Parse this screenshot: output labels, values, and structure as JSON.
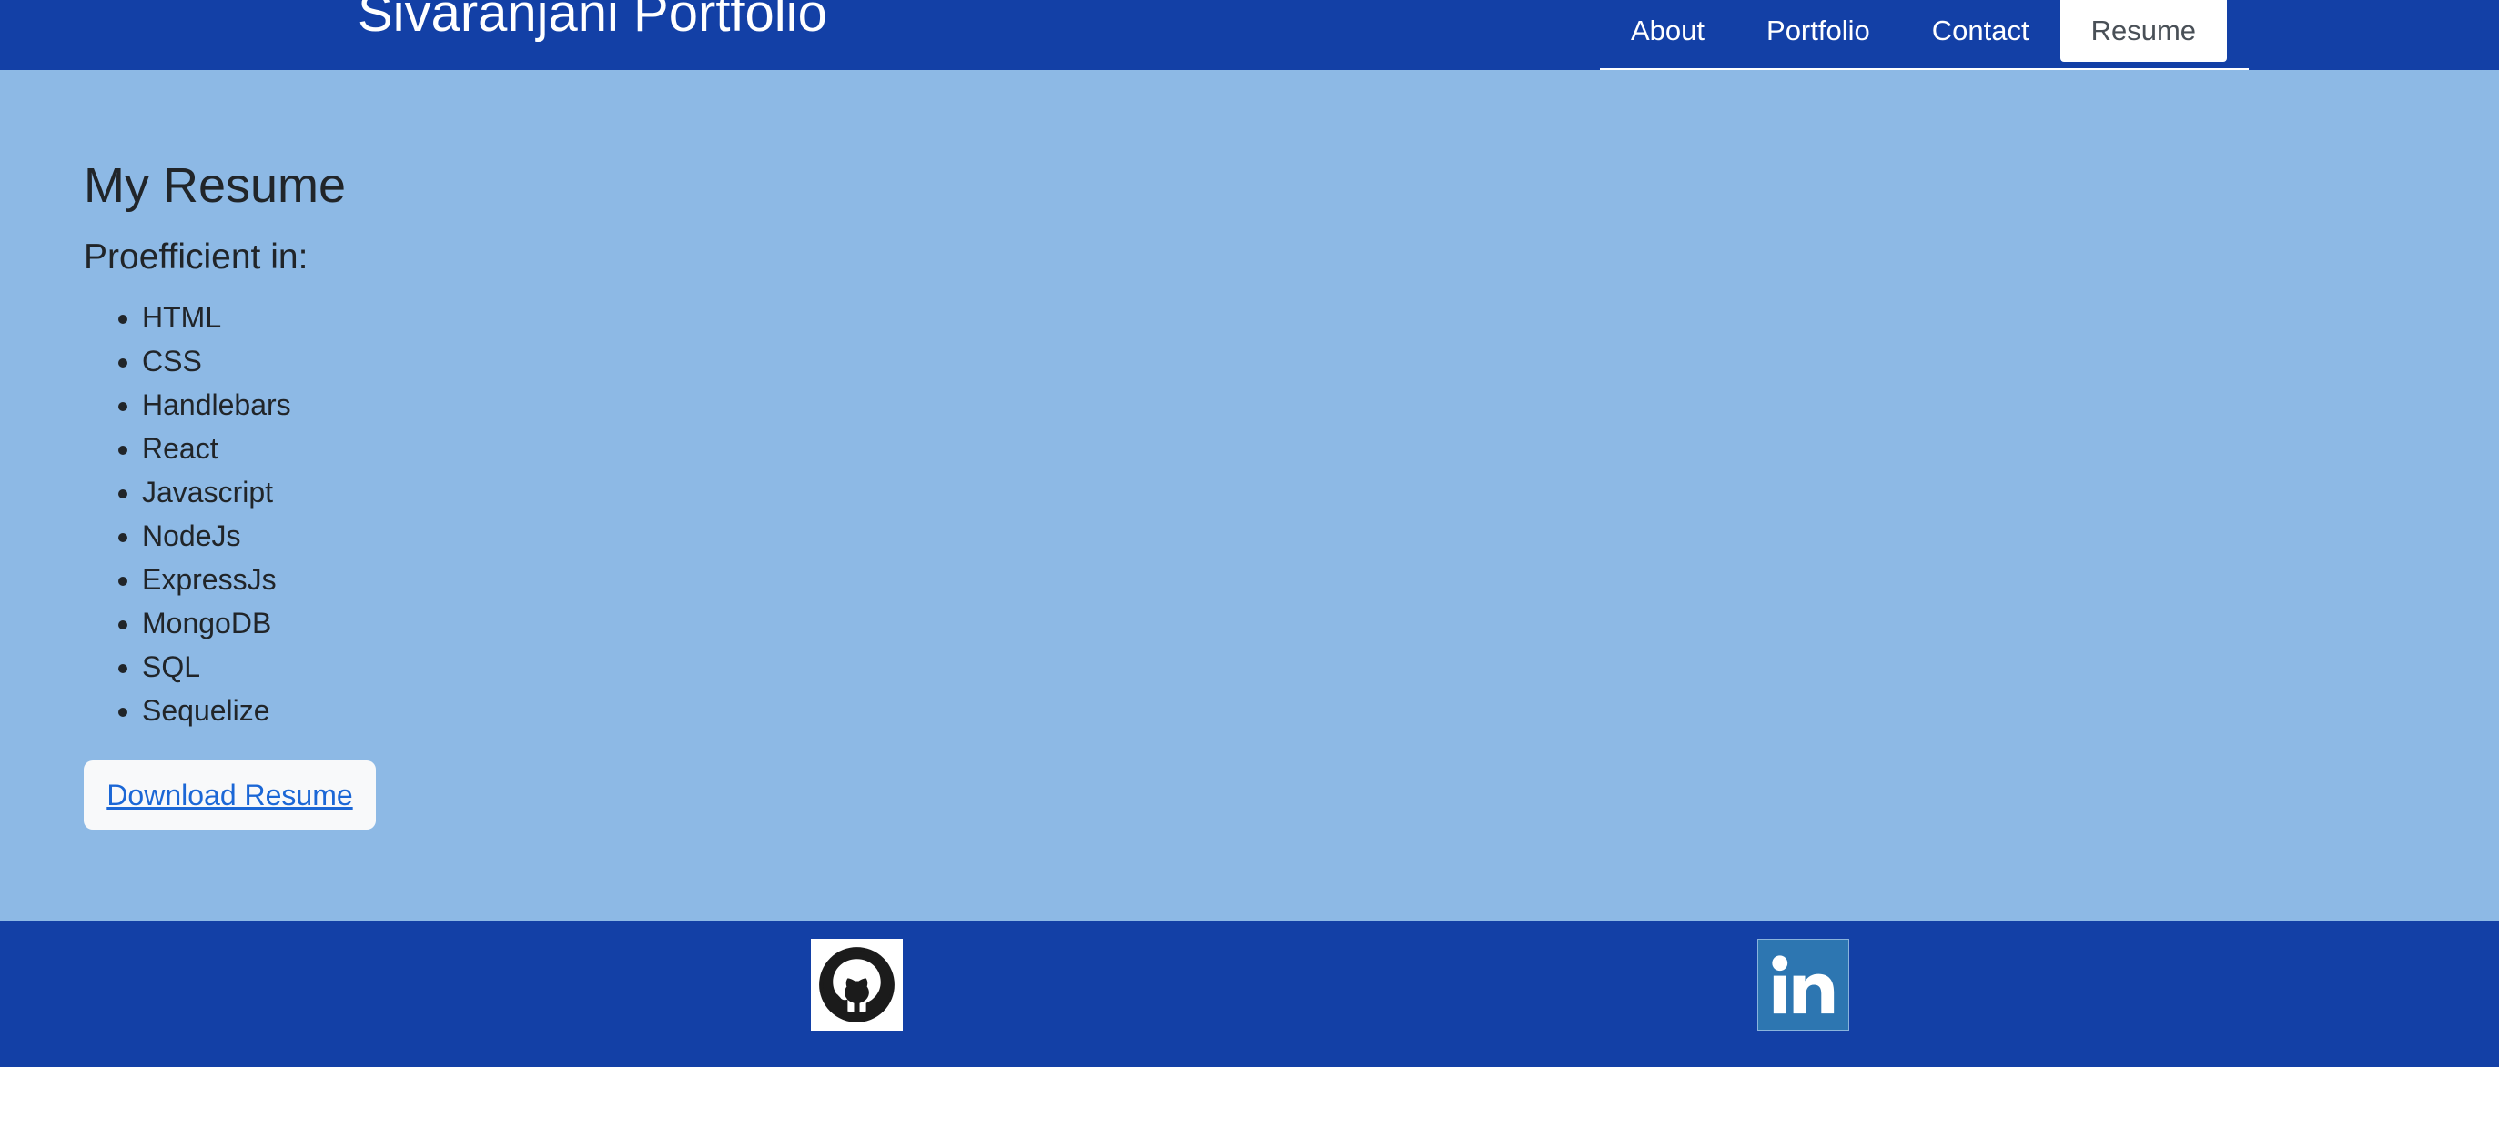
{
  "header": {
    "title": "Sivaranjani Portfolio",
    "nav": [
      {
        "label": "About"
      },
      {
        "label": "Portfolio"
      },
      {
        "label": "Contact"
      },
      {
        "label": "Resume",
        "active": true
      }
    ]
  },
  "main": {
    "title": "My Resume",
    "subtitle": "Proefficient in:",
    "skills": [
      "HTML",
      "CSS",
      "Handlebars",
      "React",
      "Javascript",
      "NodeJs",
      "ExpressJs",
      "MongoDB",
      "SQL",
      "Sequelize"
    ],
    "download_label": "Download Resume"
  },
  "footer": {
    "icons": [
      "github-icon",
      "linkedin-icon"
    ]
  },
  "colors": {
    "header_bg": "#1340a6",
    "main_bg": "#8db9e5",
    "link": "#1b67d6",
    "linkedin": "#2d76b1"
  }
}
